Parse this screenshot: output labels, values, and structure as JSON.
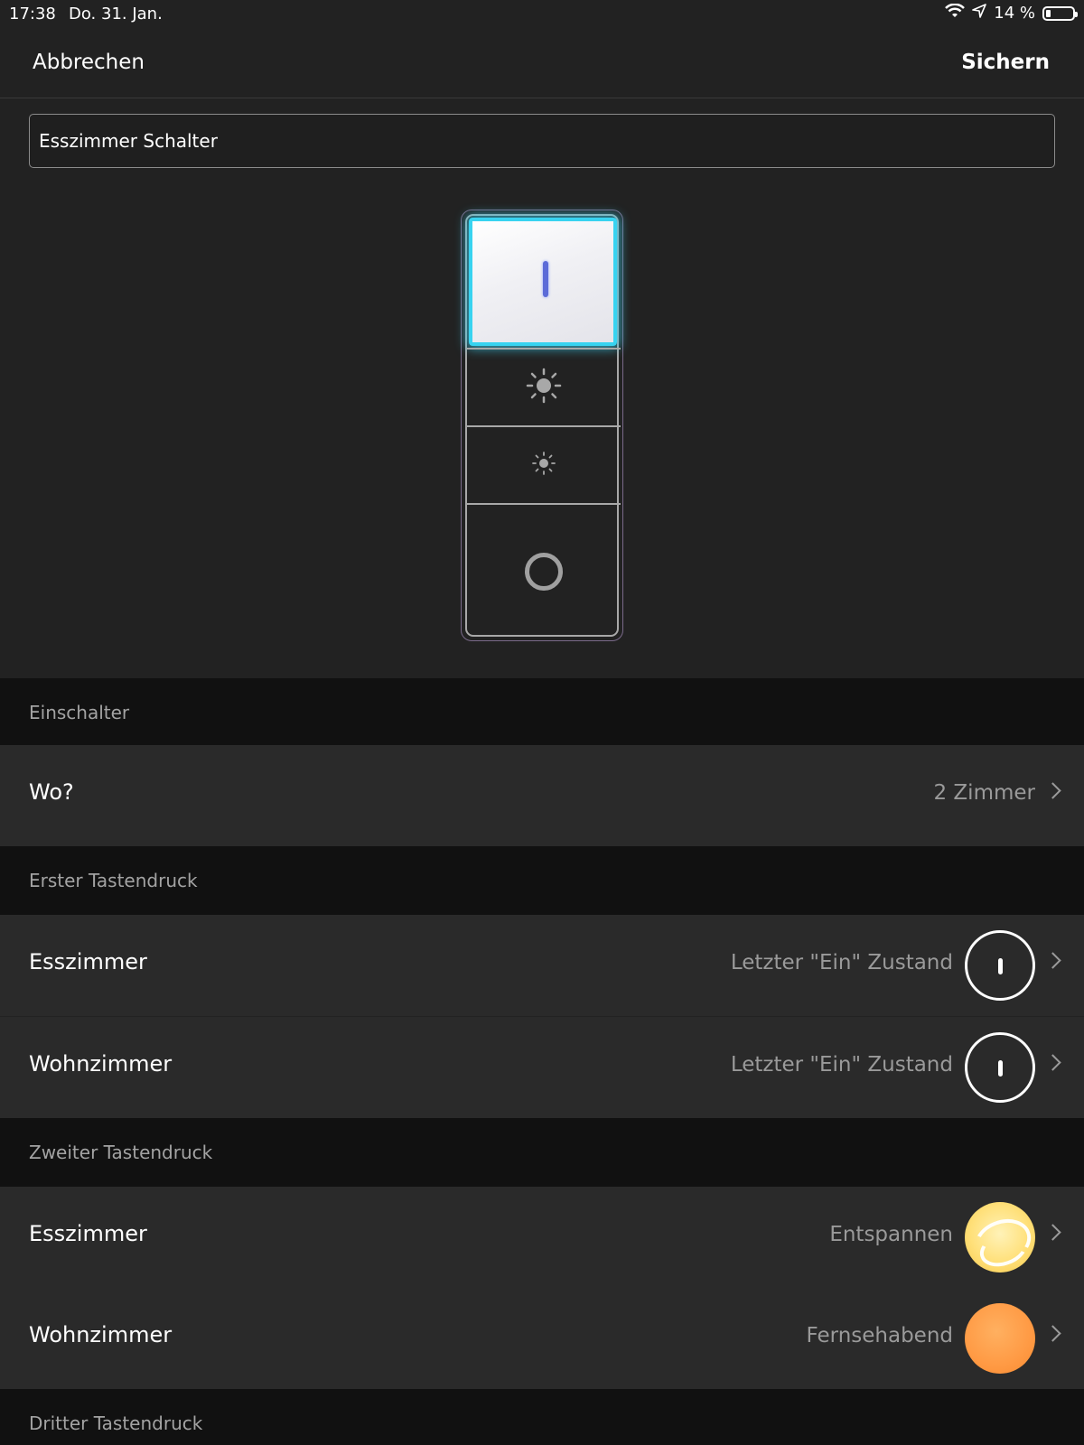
{
  "status": {
    "time": "17:38",
    "date": "Do. 31. Jan.",
    "battery": "14 %"
  },
  "nav": {
    "cancel": "Abbrechen",
    "save": "Sichern"
  },
  "name_field": {
    "value": "Esszimmer Schalter"
  },
  "sections": {
    "einschalter": "Einschalter",
    "first": "Erster Tastendruck",
    "second": "Zweiter Tastendruck",
    "third": "Dritter Tastendruck"
  },
  "where": {
    "label": "Wo?",
    "value": "2 Zimmer"
  },
  "first_press": [
    {
      "room": "Esszimmer",
      "value": "Letzter \"Ein\" Zustand",
      "icon": "power-icon"
    },
    {
      "room": "Wohnzimmer",
      "value": "Letzter \"Ein\" Zustand",
      "icon": "power-icon"
    }
  ],
  "second_press": [
    {
      "room": "Esszimmer",
      "value": "Entspannen",
      "icon": "relax-scene-icon",
      "color": "#ffe07a"
    },
    {
      "room": "Wohnzimmer",
      "value": "Fernsehabend",
      "icon": "tv-scene-icon",
      "color": "#ff9a44"
    }
  ],
  "colors": {
    "accent_glow": "#38d3f0",
    "background": "#222222",
    "section_bg": "#111111"
  }
}
